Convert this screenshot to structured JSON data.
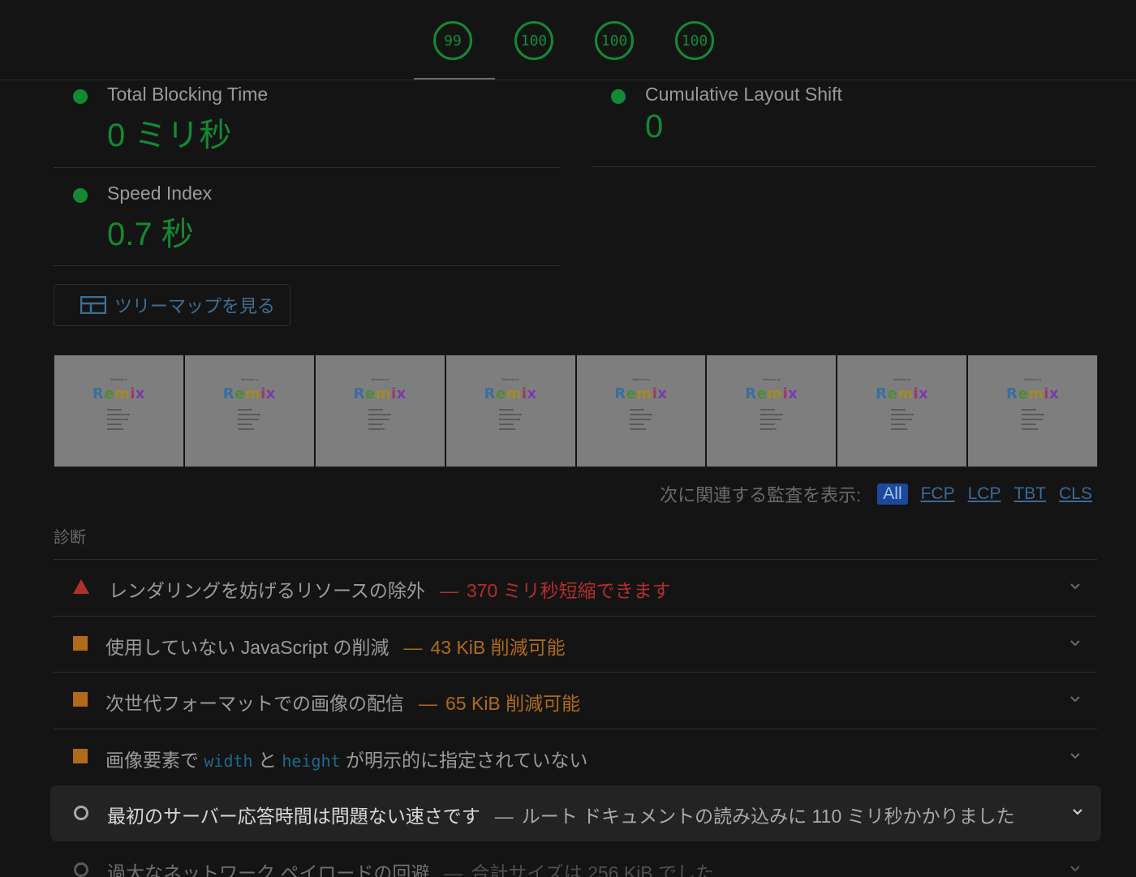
{
  "gauges": [
    {
      "score": "99",
      "color": "#138a36"
    },
    {
      "score": "100",
      "color": "#138a36"
    },
    {
      "score": "100",
      "color": "#138a36"
    },
    {
      "score": "100",
      "color": "#138a36"
    }
  ],
  "metrics": {
    "tbt": {
      "label": "Total Blocking Time",
      "value": "0 ミリ秒"
    },
    "cls": {
      "label": "Cumulative Layout Shift",
      "value": "0"
    },
    "si": {
      "label": "Speed Index",
      "value": "0.7 秒"
    }
  },
  "treemap_button": {
    "label": "ツリーマップを見る",
    "icon": "treemap-icon"
  },
  "filmstrip": {
    "frame_count": 8,
    "welcome_text": "Welcome to",
    "logo_text": "Remix"
  },
  "filter": {
    "label": "次に関連する監査を表示:",
    "chips": [
      "All",
      "FCP",
      "LCP",
      "TBT",
      "CLS"
    ],
    "active": "All"
  },
  "diagnostics": {
    "title": "診断",
    "audits": [
      {
        "severity": "fail",
        "title": "レンダリングを妨げるリソースの除外",
        "display_value": "370 ミリ秒短縮できます"
      },
      {
        "severity": "average",
        "title": "使用していない JavaScript の削減",
        "display_value": "43 KiB 削減可能"
      },
      {
        "severity": "average",
        "title": "次世代フォーマットでの画像の配信",
        "display_value": "65 KiB 削減可能"
      },
      {
        "severity": "average",
        "title_parts": [
          "画像要素で",
          "width",
          "と",
          "height",
          "が明示的に指定されていない"
        ]
      },
      {
        "severity": "informative",
        "title": "最初のサーバー応答時間は問題ない速さです",
        "display_value": "ルート ドキュメントの読み込みに 110 ミリ秒かかりました"
      },
      {
        "severity": "informative",
        "title": "過大なネットワーク ペイロードの回避",
        "display_value": "合計サイズは 256 KiB でした"
      }
    ]
  },
  "colors": {
    "pass": "#128a33",
    "fail": "#b0302a",
    "average": "#b06a1a",
    "link": "#3c6a94"
  }
}
